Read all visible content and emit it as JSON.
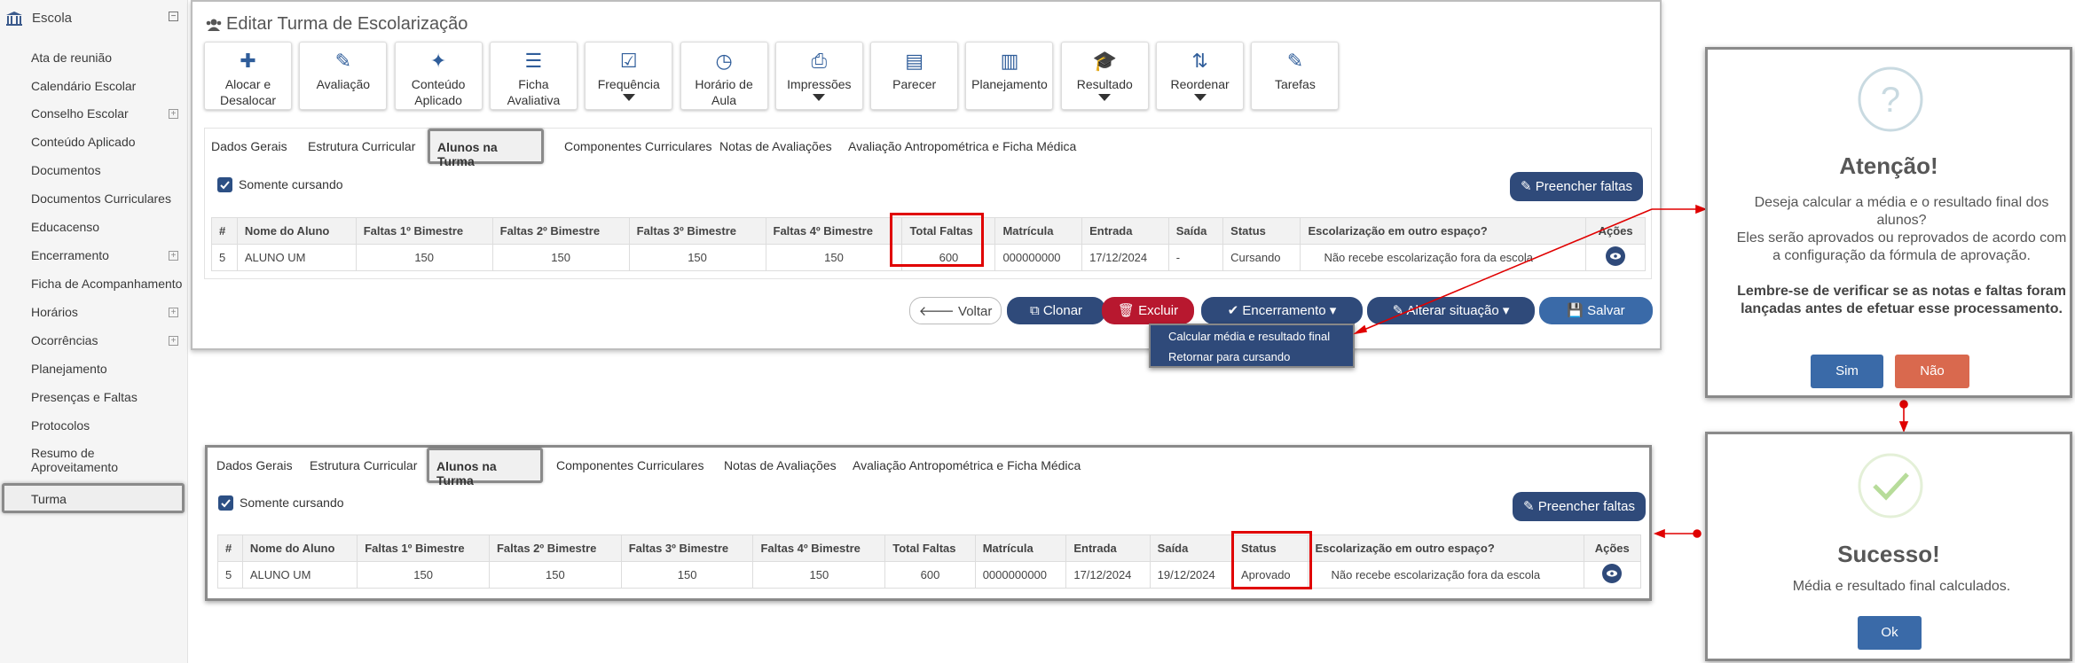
{
  "sidebar": {
    "title": "Escola",
    "items": [
      {
        "label": "Ata de reunião",
        "plus": false
      },
      {
        "label": "Calendário Escolar",
        "plus": false
      },
      {
        "label": "Conselho Escolar",
        "plus": true
      },
      {
        "label": "Conteúdo Aplicado",
        "plus": false
      },
      {
        "label": "Documentos",
        "plus": false
      },
      {
        "label": "Documentos Curriculares",
        "plus": false
      },
      {
        "label": "Educacenso",
        "plus": false
      },
      {
        "label": "Encerramento",
        "plus": true
      },
      {
        "label": "Ficha de Acompanhamento",
        "plus": false
      },
      {
        "label": "Horários",
        "plus": true
      },
      {
        "label": "Ocorrências",
        "plus": true
      },
      {
        "label": "Planejamento",
        "plus": false
      },
      {
        "label": "Presenças e Faltas",
        "plus": false
      },
      {
        "label": "Protocolos",
        "plus": false
      }
    ],
    "resumo_line1": "Resumo de",
    "resumo_line2": "Aproveitamento",
    "active": "Turma"
  },
  "page": {
    "title": "Editar Turma de Escolarização"
  },
  "toolbar": [
    {
      "icon": "puzzle-icon",
      "l1": "Alocar e",
      "l2": "Desalocar"
    },
    {
      "icon": "edit-icon",
      "l1": "Avaliação",
      "l2": ""
    },
    {
      "icon": "magic-wand-icon",
      "l1": "Conteúdo",
      "l2": "Aplicado"
    },
    {
      "icon": "list-icon",
      "l1": "Ficha",
      "l2": "Avaliativa"
    },
    {
      "icon": "check-square-icon",
      "l1": "Frequência",
      "l2": ""
    },
    {
      "icon": "clock-icon",
      "l1": "Horário de",
      "l2": "Aula"
    },
    {
      "icon": "print-icon",
      "l1": "Impressões",
      "l2": ""
    },
    {
      "icon": "file-icon",
      "l1": "Parecer",
      "l2": ""
    },
    {
      "icon": "book-icon",
      "l1": "Planejamento",
      "l2": ""
    },
    {
      "icon": "graduation-cap-icon",
      "l1": "Resultado",
      "l2": ""
    },
    {
      "icon": "sort-az-icon",
      "l1": "Reordenar",
      "l2": ""
    },
    {
      "icon": "pencil-icon",
      "l1": "Tarefas",
      "l2": ""
    }
  ],
  "tabs": [
    "Dados Gerais",
    "Estrutura Curricular",
    "Alunos na Turma",
    "Componentes Curriculares",
    "Notas de Avaliações",
    "Avaliação Antropométrica e Ficha Médica"
  ],
  "filter": {
    "somente_cursando": "Somente cursando"
  },
  "fill_button": "Preencher faltas",
  "table": {
    "headers": [
      "#",
      "Nome do Aluno",
      "Faltas 1º Bimestre",
      "Faltas 2º Bimestre",
      "Faltas 3º Bimestre",
      "Faltas 4º Bimestre",
      "Total Faltas",
      "Matrícula",
      "Entrada",
      "Saída",
      "Status",
      "Escolarização em outro espaço?",
      "Ações"
    ],
    "before": [
      "5",
      "ALUNO UM",
      "150",
      "150",
      "150",
      "150",
      "600",
      "000000000",
      "17/12/2024",
      "-",
      "Cursando",
      "Não recebe escolarização fora da escola"
    ],
    "after": [
      "5",
      "ALUNO UM",
      "150",
      "150",
      "150",
      "150",
      "600",
      "0000000000",
      "17/12/2024",
      "19/12/2024",
      "Aprovado",
      "Não recebe escolarização fora da escola"
    ]
  },
  "actions": {
    "voltar": "Voltar",
    "clonar": "Clonar",
    "excluir": "Excluir",
    "encerramento": "Encerramento",
    "alterar": "Alterar situação",
    "salvar": "Salvar"
  },
  "dropdown": [
    "Calcular média e resultado final",
    "Retornar para cursando"
  ],
  "modal_confirm": {
    "icon": "?",
    "title": "Atenção!",
    "text1": "Deseja calcular a média e o resultado final dos alunos?",
    "text2": "Eles serão aprovados ou reprovados de acordo com a configuração da fórmula de aprovação.",
    "bold": "Lembre-se de verificar se as notas e faltas foram lançadas antes de efetuar esse processamento.",
    "yes": "Sim",
    "no": "Não"
  },
  "modal_success": {
    "title": "Sucesso!",
    "text": "Média e resultado final calculados.",
    "ok": "Ok"
  },
  "colors": {
    "primary": "#2f4a7a",
    "danger": "#b8182f",
    "highlight": "#e00000",
    "no": "#d9694e",
    "confirm": "#3a6aa8",
    "success_check": "#b7dc9a"
  }
}
